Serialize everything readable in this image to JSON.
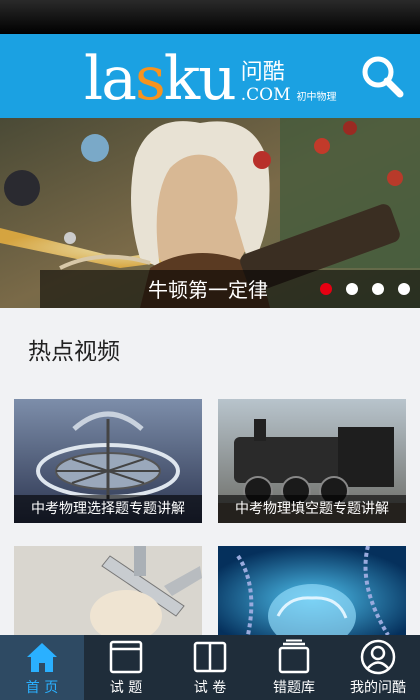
{
  "header": {
    "logo_word_1": "la",
    "logo_word_k": "s",
    "logo_word_2": "ku",
    "logo_cn": "问酷",
    "logo_com": ".COM",
    "logo_sub": "初中物理",
    "search_icon": "search-icon"
  },
  "banner": {
    "caption": "牛顿第一定律",
    "slide_count": 4,
    "active_slide": 1
  },
  "section": {
    "title": "热点视频"
  },
  "videos": [
    {
      "caption": "中考物理选择题专题讲解",
      "image": "gyroscope"
    },
    {
      "caption": "中考物理填空题专题讲解",
      "image": "steam-locomotive"
    },
    {
      "caption": "",
      "image": "vernier-caliper-egg"
    },
    {
      "caption": "",
      "image": "brain-dna"
    }
  ],
  "tabbar": {
    "items": [
      {
        "label": "首 页",
        "icon": "home-icon",
        "active": true
      },
      {
        "label": "试 题",
        "icon": "question-sheet-icon",
        "active": false
      },
      {
        "label": "试 卷",
        "icon": "book-icon",
        "active": false
      },
      {
        "label": "错题库",
        "icon": "stack-icon",
        "active": false
      },
      {
        "label": "我的问酷",
        "icon": "user-icon",
        "active": false
      }
    ]
  },
  "colors": {
    "header_bg": "#1ba1e2",
    "accent_orange": "#f7931e",
    "active_dot": "#e60012",
    "tabbar_bg": "#1f2d3a",
    "tab_active_text": "#2ab0ff"
  }
}
